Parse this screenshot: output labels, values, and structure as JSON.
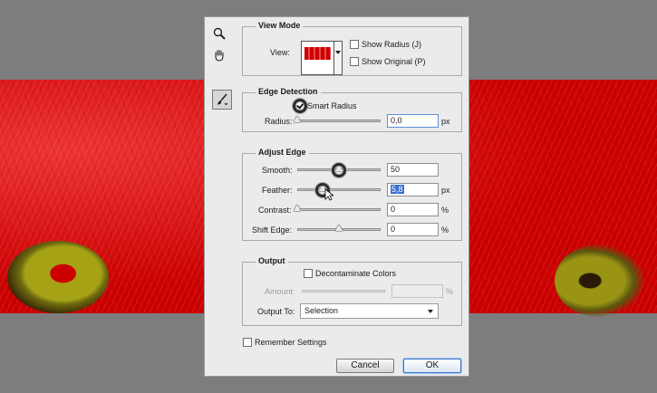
{
  "view_mode": {
    "title": "View Mode",
    "view_label": "View:",
    "show_radius": {
      "label": "Show Radius (J)",
      "checked": false
    },
    "show_original": {
      "label": "Show Original (P)",
      "checked": false
    }
  },
  "edge_detection": {
    "title": "Edge Detection",
    "smart_radius": {
      "label": "Smart Radius",
      "checked": true
    },
    "radius_label": "Radius:",
    "radius_value": "0,0",
    "radius_unit": "px",
    "radius_level": 0
  },
  "adjust_edge": {
    "title": "Adjust Edge",
    "smooth": {
      "label": "Smooth:",
      "value": "50",
      "unit": "",
      "level": 0.5
    },
    "feather": {
      "label": "Feather:",
      "value": "5,8",
      "unit": "px",
      "level": 0.3
    },
    "contrast": {
      "label": "Contrast:",
      "value": "0",
      "unit": "%",
      "level": 0
    },
    "shift_edge": {
      "label": "Shift Edge:",
      "value": "0",
      "unit": "%",
      "level": 0.5
    }
  },
  "output": {
    "title": "Output",
    "decontaminate": {
      "label": "Decontaminate Colors",
      "checked": false
    },
    "amount_label": "Amount:",
    "amount_value": "",
    "amount_unit": "%",
    "output_to_label": "Output To:",
    "output_to_value": "Selection"
  },
  "remember_settings": {
    "label": "Remember Settings",
    "checked": false
  },
  "buttons": {
    "cancel": "Cancel",
    "ok": "OK"
  },
  "tools": [
    "zoom-icon",
    "hand-icon",
    "refine-brush-icon"
  ],
  "colors": {
    "overlay": "#c80000",
    "dialog_bg": "#ebebeb",
    "ok_accent": "#3f78c8"
  }
}
